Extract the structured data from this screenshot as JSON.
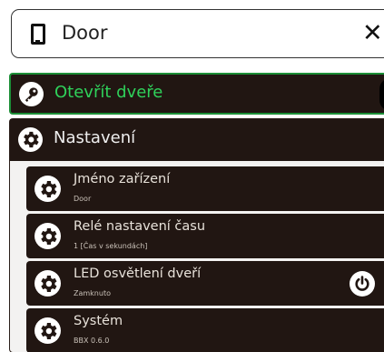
{
  "header": {
    "title": "Door",
    "device_icon": "phone-icon",
    "close_icon": "close-icon",
    "close_glyph": "✕"
  },
  "open_door": {
    "label": "Otevřít dveře",
    "icon": "key-icon",
    "accent_color": "#1c8f37",
    "label_color": "#2fd15a"
  },
  "settings": {
    "label": "Nastavení",
    "icon": "gear-icon",
    "items": [
      {
        "title": "Jméno zařízení",
        "subtitle": "Door",
        "icon": "gear-icon"
      },
      {
        "title": "Relé nastavení času",
        "subtitle": "1 [Čas v sekundách]",
        "icon": "gear-icon"
      },
      {
        "title": "LED osvětlení dveří",
        "subtitle": "Zamknuto",
        "icon": "gear-icon",
        "action_icon": "power-icon"
      },
      {
        "title": "Systém",
        "subtitle": "BBX 0.6.0",
        "icon": "gear-icon"
      }
    ]
  },
  "colors": {
    "panel_dark": "#211612",
    "panel_light": "#f3f2f1"
  }
}
